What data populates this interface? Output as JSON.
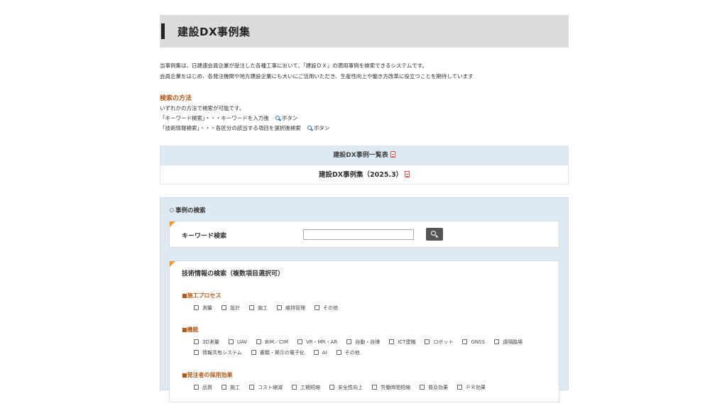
{
  "header": {
    "title": "建設DX事例集"
  },
  "intro": {
    "line1": "当事例集は、日建連会員企業が受注した各種工事において、「建設ＤＸ」の適用事例を検索できるシステムです。",
    "line2": "会員企業をはじめ、各発注機関や地方建設企業にも大いにご活用いただき、生産性向上や働き方改革に役立つことを期待しています"
  },
  "howto": {
    "title": "検索の方法",
    "line1": "いずれかの方法で検索が可能です。",
    "line2": "「キーワード検索」・・・キーワードを入力後",
    "line3": "「技術情報検索」・・・各区分の該当する項目を選択後検索",
    "button_word": "ボタン"
  },
  "list": {
    "header": "建設DX事例一覧表",
    "item": "建設DX事例集（2025.3）"
  },
  "search": {
    "section_title": "事例の検索",
    "keyword_label": "キーワード検索",
    "keyword_value": "",
    "tech_title": "技術情報の検索（複数項目選択可）",
    "groups": [
      {
        "title": "■施工プロセス",
        "options": [
          "測量",
          "設計",
          "施工",
          "維持管理",
          "その他"
        ]
      },
      {
        "title": "■機能",
        "options": [
          "3D測量",
          "UAV",
          "BIM／CIM",
          "VR・MR・AR",
          "自動・自律",
          "ICT建機",
          "ロボット",
          "GNSS",
          "遠隔臨場",
          "情報共有システム",
          "書類・掲示の電子化",
          "AI",
          "その他"
        ]
      },
      {
        "title": "■発注者の採用効果",
        "options": [
          "品質",
          "施工",
          "コスト縮減",
          "工期短縮",
          "安全性向上",
          "労働時間短縮",
          "普及効果",
          "ＰＲ効果"
        ]
      }
    ]
  }
}
